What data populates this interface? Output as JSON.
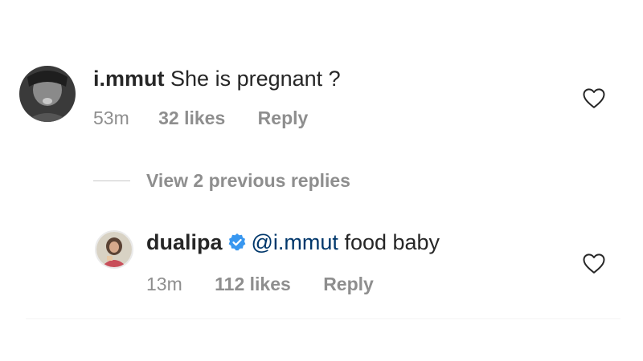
{
  "comment": {
    "username": "i.mmut",
    "text": "She is pregnant ?",
    "time": "53m",
    "likes": "32 likes",
    "reply_label": "Reply"
  },
  "view_replies": {
    "label": "View 2 previous replies"
  },
  "reply": {
    "username": "dualipa",
    "mention": "@i.mmut",
    "text": "food baby",
    "time": "13m",
    "likes": "112 likes",
    "reply_label": "Reply"
  },
  "icons": {
    "like": "heart-outline-icon",
    "verified": "verified-badge-icon"
  },
  "colors": {
    "text": "#262626",
    "muted": "#8e8e8e",
    "mention": "#00376b",
    "verified": "#3897f0"
  }
}
